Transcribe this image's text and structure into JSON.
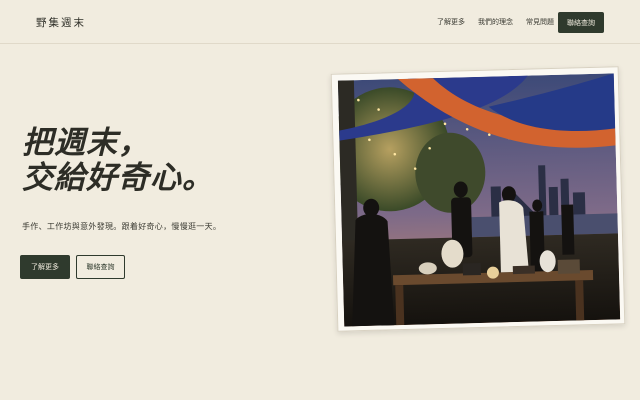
{
  "header": {
    "brand": "野集週末",
    "nav": [
      "了解更多",
      "我們的理念",
      "常見問題"
    ],
    "cta": "聯絡查詢"
  },
  "hero": {
    "headline_line1": "把週末，",
    "headline_line2": "交給好奇心。",
    "subtext": "手作、工作坊與意外發現。跟着好奇心，慢慢逛一天。",
    "primary_button": "了解更多",
    "secondary_button": "聯絡查詢"
  },
  "colors": {
    "background": "#f1ecdf",
    "primary": "#2f3a2d",
    "text": "#2f2f28"
  }
}
